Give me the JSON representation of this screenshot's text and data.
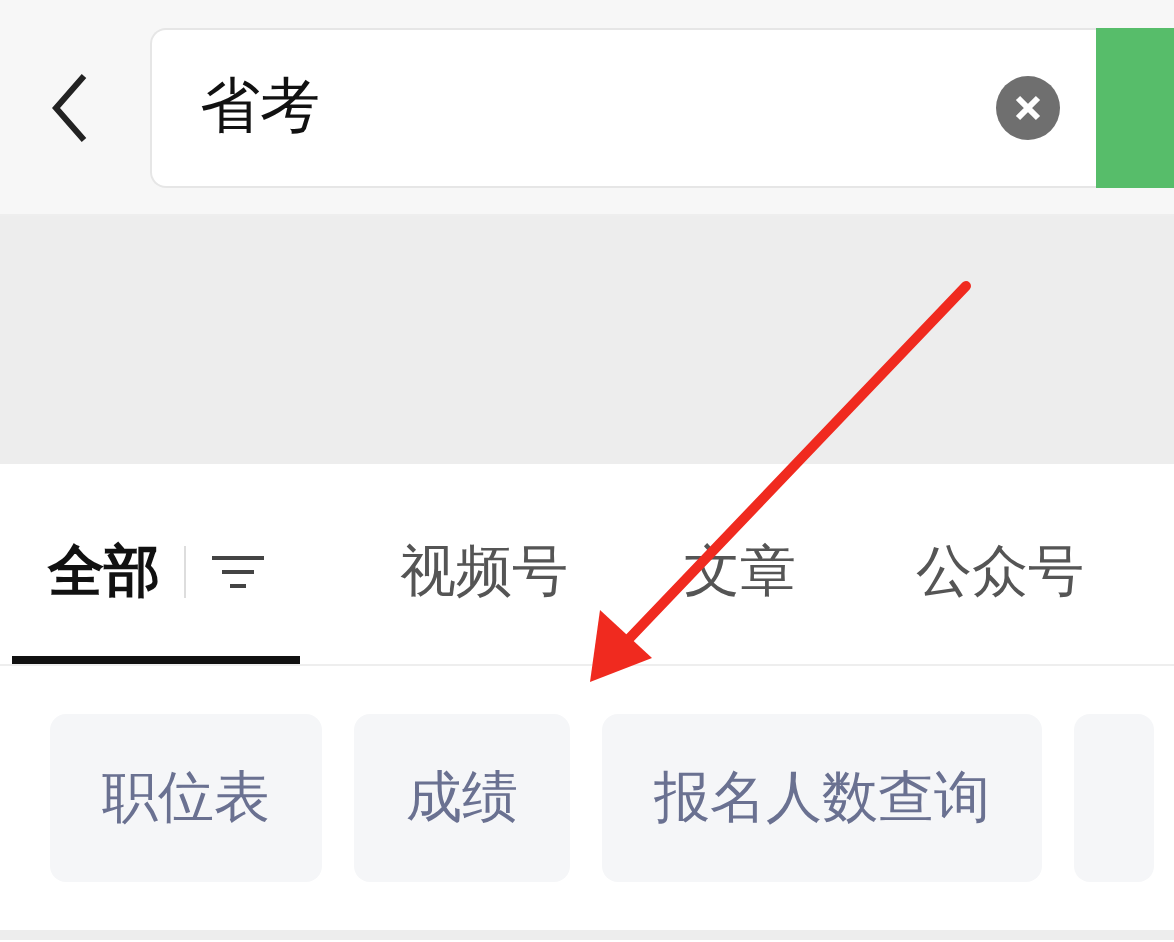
{
  "search": {
    "value": "省考"
  },
  "tabs": [
    {
      "label": "全部",
      "selected": true
    },
    {
      "label": "视频号",
      "selected": false
    },
    {
      "label": "文章",
      "selected": false
    },
    {
      "label": "公众号",
      "selected": false
    }
  ],
  "suggestions": [
    {
      "label": "职位表"
    },
    {
      "label": "成绩"
    },
    {
      "label": "报名人数查询"
    }
  ]
}
